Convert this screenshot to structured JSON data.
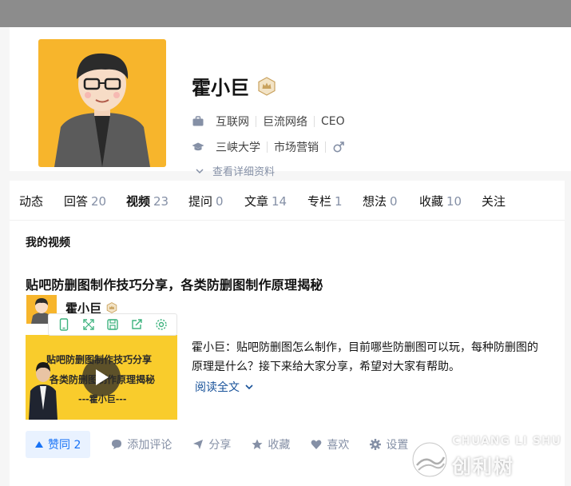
{
  "profile": {
    "name": "霍小巨",
    "work": {
      "industry": "互联网",
      "company": "巨流网络",
      "title": "CEO"
    },
    "education": {
      "school": "三峡大学",
      "major": "市场营销",
      "gender_icon": "male-icon"
    },
    "details_label": "查看详细资料"
  },
  "tabs": [
    {
      "label": "动态",
      "count": ""
    },
    {
      "label": "回答",
      "count": "20"
    },
    {
      "label": "视频",
      "count": "23"
    },
    {
      "label": "提问",
      "count": "0"
    },
    {
      "label": "文章",
      "count": "14"
    },
    {
      "label": "专栏",
      "count": "1"
    },
    {
      "label": "想法",
      "count": "0"
    },
    {
      "label": "收藏",
      "count": "10"
    },
    {
      "label": "关注",
      "count": ""
    }
  ],
  "active_tab": "视频",
  "section_title": "我的视频",
  "video": {
    "title": "贴吧防删图制作技巧分享，各类防删图制作原理揭秘",
    "author": "霍小巨",
    "thumbnail_lines": [
      "贴吧防删图制作技巧分享",
      "各类防删图制作原理揭秘",
      "---霍小巨---"
    ],
    "excerpt": "霍小巨：贴吧防删图怎么制作，目前哪些防删图可以玩，每种防删图的原理是什么？接下来给大家分享，希望对大家有帮助。",
    "read_more": "阅读全文"
  },
  "actions": {
    "vote": "赞同 2",
    "comment": "添加评论",
    "share": "分享",
    "favorite": "收藏",
    "like": "喜欢",
    "settings": "设置"
  },
  "watermark": {
    "top": "CHUANG LI SHU",
    "bottom": "创利树"
  },
  "colors": {
    "cover": "#8c8c8c",
    "avatar_bg": "#f7b52c",
    "accent": "#1772f6",
    "link": "#175199",
    "muted": "#8590a6"
  }
}
